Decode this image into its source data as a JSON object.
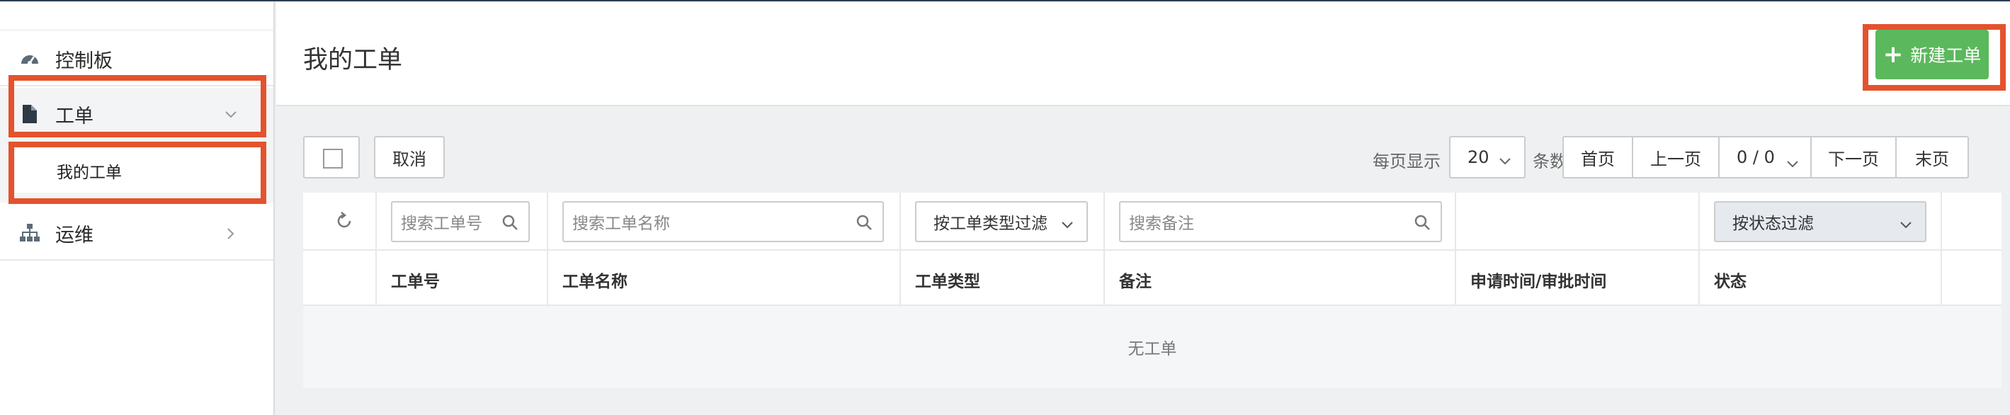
{
  "sidebar": {
    "items": [
      {
        "label": "控制板",
        "icon": "dashboard-icon"
      },
      {
        "label": "工单",
        "icon": "file-icon",
        "expanded": true,
        "children": [
          {
            "label": "我的工单"
          }
        ]
      },
      {
        "label": "运维",
        "icon": "sitemap-icon",
        "expanded": false
      }
    ]
  },
  "header": {
    "title": "我的工单",
    "new_button": "新建工单"
  },
  "toolbar": {
    "cancel_label": "取消",
    "per_page_label": "每页显示",
    "per_page_value": "20",
    "rows_label": "条数据",
    "pager": {
      "first": "首页",
      "prev": "上一页",
      "page_indicator": "0 / 0",
      "next": "下一页",
      "last": "末页"
    }
  },
  "table": {
    "filters": {
      "id_placeholder": "搜索工单号",
      "name_placeholder": "搜索工单名称",
      "type_filter": "按工单类型过滤",
      "note_placeholder": "搜索备注",
      "status_filter": "按状态过滤"
    },
    "columns": [
      "工单号",
      "工单名称",
      "工单类型",
      "备注",
      "申请时间/审批时间",
      "状态"
    ],
    "empty_text": "无工单"
  },
  "colors": {
    "accent_green": "#5cb85c",
    "highlight_red": "#e4522e"
  }
}
